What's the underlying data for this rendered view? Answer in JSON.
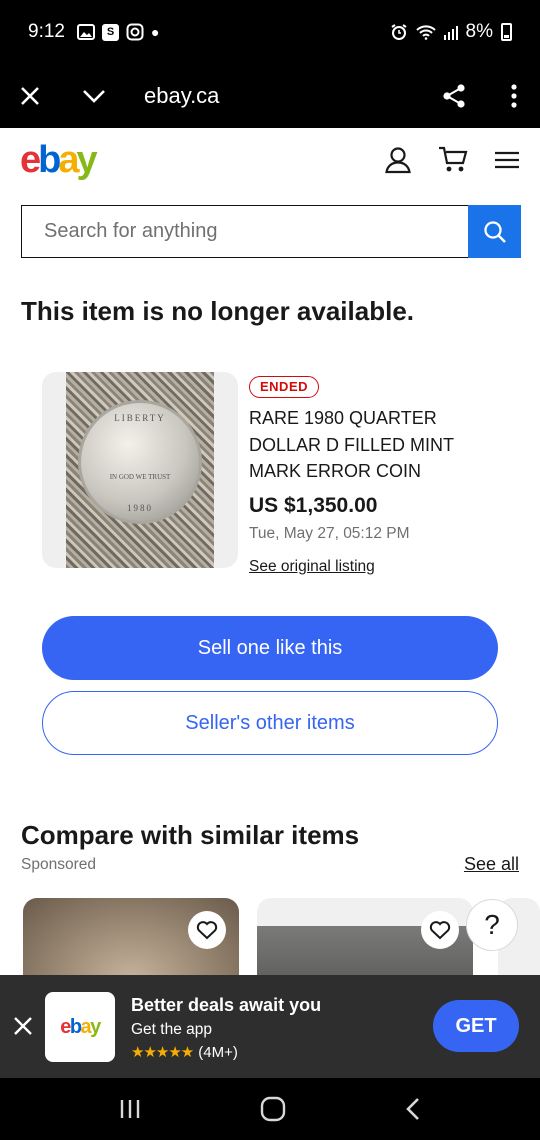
{
  "status_bar": {
    "time": "9:12",
    "battery": "8%"
  },
  "browser": {
    "url": "ebay.ca"
  },
  "header": {
    "logo_letters": [
      "e",
      "b",
      "a",
      "y"
    ]
  },
  "search": {
    "placeholder": "Search for anything"
  },
  "page": {
    "heading": "This item is no longer available."
  },
  "item": {
    "badge": "ENDED",
    "title": "RARE 1980 QUARTER DOLLAR D FILLED MINT MARK ERROR COIN",
    "price": "US $1,350.00",
    "date": "Tue, May 27, 05:12 PM",
    "original_link": "See original listing",
    "image_text": {
      "top": "LIBERTY",
      "year": "1980",
      "motto": "IN GOD WE TRUST"
    }
  },
  "actions": {
    "sell_label": "Sell one like this",
    "seller_items_label": "Seller's other items"
  },
  "similar": {
    "heading": "Compare with similar items",
    "sponsored": "Sponsored",
    "see_all": "See all"
  },
  "help": {
    "label": "?"
  },
  "app_banner": {
    "logo_letters": [
      "e",
      "b",
      "a",
      "y"
    ],
    "title": "Better deals await you",
    "subtitle": "Get the app",
    "stars": "★★★★★",
    "rating_count": "(4M+)",
    "get_label": "GET"
  },
  "colors": {
    "accent": "#3665f3",
    "ended": "#d50b0b",
    "logo_red": "#e53238",
    "logo_blue": "#0064d2",
    "logo_yellow": "#f5af02",
    "logo_green": "#86b817"
  }
}
